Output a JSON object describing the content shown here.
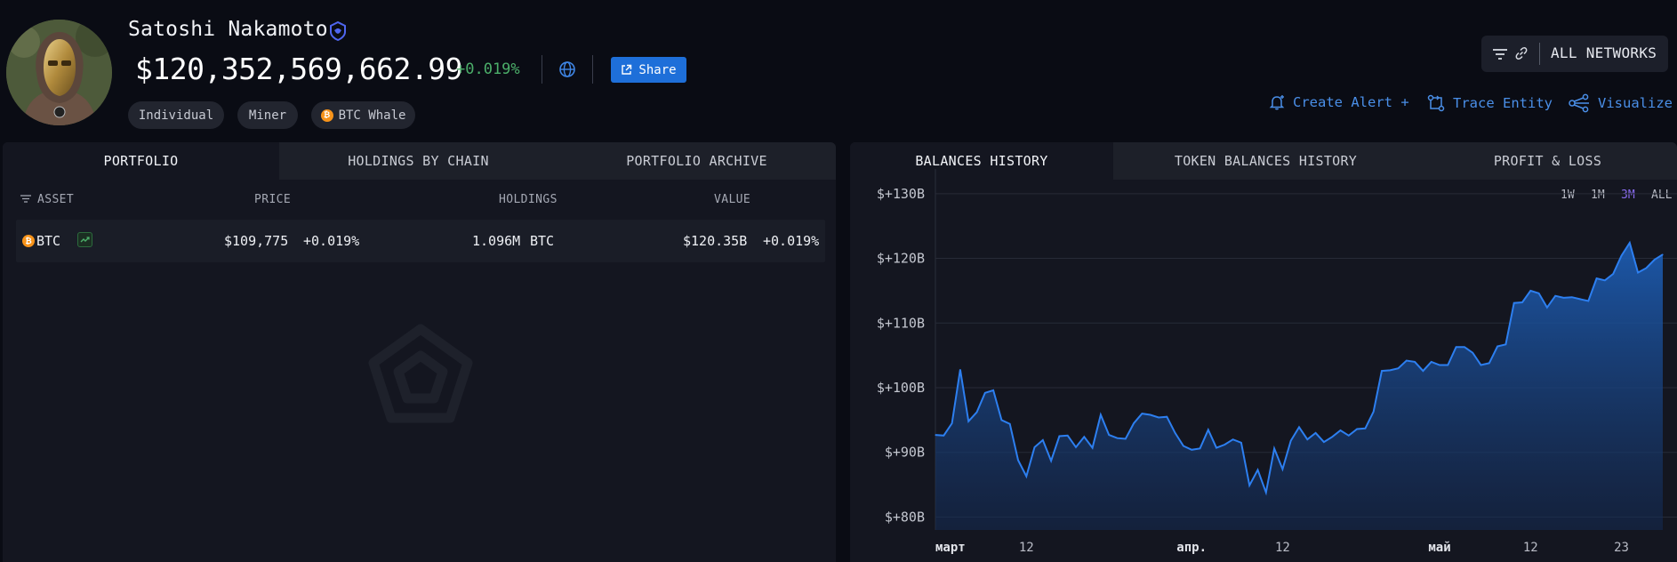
{
  "profile": {
    "name": "Satoshi Nakamoto",
    "balance": "$120,352,569,662.99",
    "balance_change": "+0.019%",
    "share_label": "Share",
    "tags": [
      "Individual",
      "Miner",
      "BTC Whale"
    ]
  },
  "networks": {
    "label": "ALL NETWORKS"
  },
  "actions": {
    "create_alert": "Create Alert +",
    "trace_entity": "Trace Entity",
    "visualize": "Visualize"
  },
  "left_panel": {
    "tabs": [
      "PORTFOLIO",
      "HOLDINGS BY CHAIN",
      "PORTFOLIO ARCHIVE"
    ],
    "active_tab": "PORTFOLIO",
    "columns": {
      "asset": "ASSET",
      "price": "PRICE",
      "holdings": "HOLDINGS",
      "value": "VALUE"
    },
    "rows": [
      {
        "asset": "BTC",
        "price": "$109,775",
        "price_change": "+0.019%",
        "holdings": "1.096M",
        "holdings_unit": "BTC",
        "value": "$120.35B",
        "value_change": "+0.019%"
      }
    ]
  },
  "right_panel": {
    "tabs": [
      "BALANCES HISTORY",
      "TOKEN BALANCES HISTORY",
      "PROFIT & LOSS"
    ],
    "active_tab": "BALANCES HISTORY",
    "ranges": [
      "1W",
      "1M",
      "3M",
      "ALL"
    ],
    "active_range": "3M"
  },
  "colors": {
    "accent_blue": "#1e6fd9",
    "positive": "#4caf6a",
    "active_range": "#8a6cf0",
    "chart_line": "#2d7ff0"
  },
  "chart_data": {
    "type": "area",
    "title": "",
    "xlabel": "",
    "ylabel": "",
    "y_tick_labels": [
      "$+80B",
      "$+90B",
      "$+100B",
      "$+110B",
      "$+120B",
      "$+130B"
    ],
    "y_ticks": [
      80,
      90,
      100,
      110,
      120,
      130
    ],
    "ylim": [
      78,
      133
    ],
    "x_tick_labels": [
      {
        "label": "март",
        "index": 0,
        "month": true
      },
      {
        "label": "12",
        "index": 11
      },
      {
        "label": "апр.",
        "index": 31,
        "month": true
      },
      {
        "label": "12",
        "index": 42
      },
      {
        "label": "май",
        "index": 61,
        "month": true
      },
      {
        "label": "12",
        "index": 72
      },
      {
        "label": "23",
        "index": 83
      }
    ],
    "grid": true,
    "series": [
      {
        "values": [
          92.7,
          92.6,
          94.5,
          102.8,
          94.8,
          96.2,
          99.2,
          99.6,
          95.0,
          94.4,
          88.8,
          86.3,
          90.8,
          91.9,
          88.7,
          92.5,
          92.6,
          90.8,
          92.4,
          90.7,
          95.8,
          92.7,
          92.2,
          92.1,
          94.5,
          96.0,
          95.8,
          95.4,
          95.5,
          93.0,
          91.0,
          90.4,
          90.6,
          93.5,
          90.7,
          91.2,
          92.0,
          91.5,
          84.9,
          87.3,
          83.8,
          90.6,
          87.4,
          91.8,
          93.9,
          92.0,
          93.0,
          91.6,
          92.4,
          93.4,
          92.6,
          93.6,
          93.7,
          96.3,
          102.6,
          102.7,
          103.0,
          104.2,
          104.0,
          102.6,
          104.0,
          103.5,
          103.5,
          106.3,
          106.3,
          105.4,
          103.5,
          103.8,
          106.4,
          106.7,
          113.1,
          113.2,
          115.0,
          114.6,
          112.4,
          114.2,
          113.9,
          114.0,
          113.7,
          113.4,
          116.9,
          116.6,
          117.6,
          120.4,
          122.4,
          117.8,
          118.5,
          119.8,
          120.6
        ]
      }
    ]
  }
}
